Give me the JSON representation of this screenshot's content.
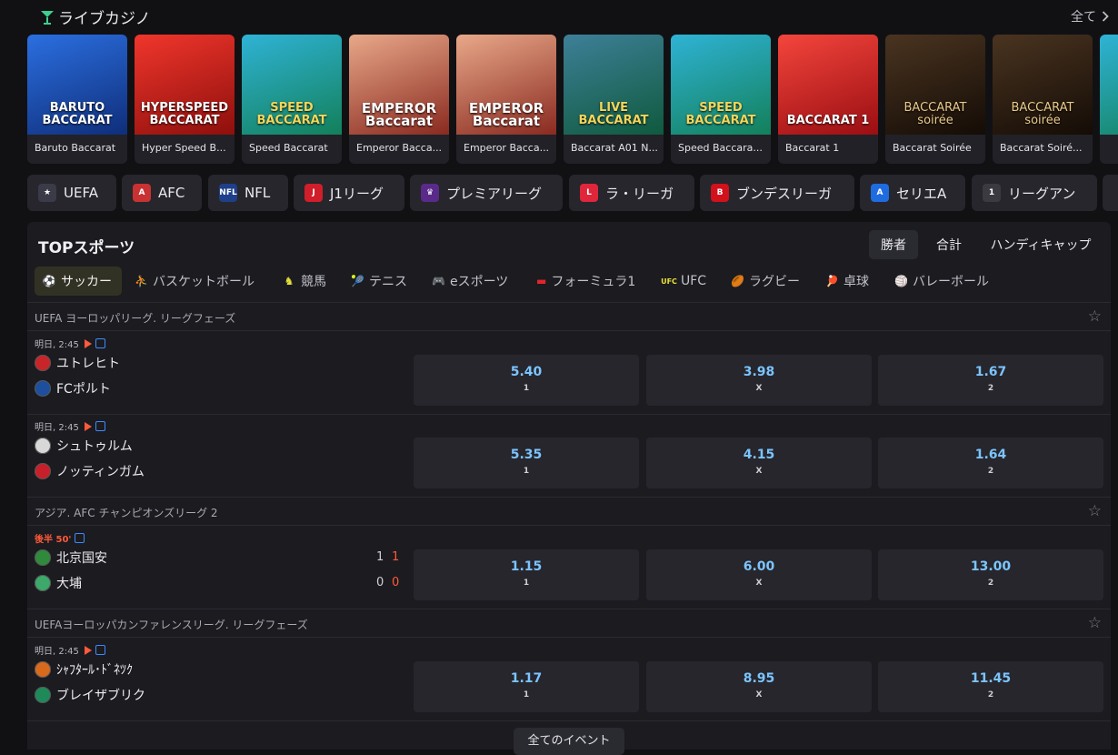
{
  "header": {
    "title": "ライブカジノ",
    "all_label": "全て"
  },
  "casino_cards": [
    {
      "name": "Baruto Baccarat",
      "art_label": "BARUTO\nBACCARAT",
      "bg": "#1a4fb8"
    },
    {
      "name": "Hyper Speed B...",
      "art_label": "HYPERSPEED\nBACCARAT",
      "bg": "#d4201c"
    },
    {
      "name": "Speed Baccarat",
      "art_label": "SPEED\nBACCARAT",
      "bg": "#1f8a6e"
    },
    {
      "name": "Emperor Bacca...",
      "art_label": "EMPEROR\nBaccarat",
      "bg": "#b03a2a"
    },
    {
      "name": "Emperor Bacca...",
      "art_label": "EMPEROR\nBaccarat",
      "bg": "#b03a2a"
    },
    {
      "name": "Baccarat A01 N...",
      "art_label": "LIVE\nBACCARAT",
      "bg": "#2d6e7e"
    },
    {
      "name": "Speed Baccara...",
      "art_label": "SPEED\nBACCARAT",
      "bg": "#1f8a6e"
    },
    {
      "name": "Baccarat 1",
      "art_label": "BACCARAT 1",
      "bg": "#c8161e"
    },
    {
      "name": "Baccarat Soirée",
      "art_label": "BACCARAT\nsoirée",
      "bg": "#2a1c10"
    },
    {
      "name": "Baccarat Soiré...",
      "art_label": "BACCARAT\nsoirée",
      "bg": "#2a1c10"
    }
  ],
  "leagues": [
    {
      "label": "UEFA",
      "icon": "uefa-icon",
      "color": "#3a3a48"
    },
    {
      "label": "AFC",
      "icon": "afc-icon",
      "color": "#c83232"
    },
    {
      "label": "NFL",
      "icon": "nfl-icon",
      "color": "#1f3f8a"
    },
    {
      "label": "J1リーグ",
      "icon": "j1-icon",
      "color": "#d01e2a"
    },
    {
      "label": "プレミアリーグ",
      "icon": "premier-league-icon",
      "color": "#5a2a8a"
    },
    {
      "label": "ラ・リーガ",
      "icon": "laliga-icon",
      "color": "#e0263a"
    },
    {
      "label": "ブンデスリーガ",
      "icon": "bundesliga-icon",
      "color": "#d1111b"
    },
    {
      "label": "セリエA",
      "icon": "serie-a-icon",
      "color": "#1f6ce0"
    },
    {
      "label": "リーグアン",
      "icon": "ligue1-icon",
      "color": "#3a3a40"
    }
  ],
  "panel": {
    "title": "TOPスポーツ",
    "markets": [
      "勝者",
      "合計",
      "ハンディキャップ"
    ],
    "sports": [
      {
        "label": "サッカー",
        "icon": "soccer-icon"
      },
      {
        "label": "バスケットボール",
        "icon": "basketball-icon"
      },
      {
        "label": "競馬",
        "icon": "horse-racing-icon"
      },
      {
        "label": "テニス",
        "icon": "tennis-icon"
      },
      {
        "label": "eスポーツ",
        "icon": "esports-icon"
      },
      {
        "label": "フォーミュラ1",
        "icon": "formula1-icon"
      },
      {
        "label": "UFC",
        "icon": "ufc-icon"
      },
      {
        "label": "ラグビー",
        "icon": "rugby-icon"
      },
      {
        "label": "卓球",
        "icon": "table-tennis-icon"
      },
      {
        "label": "バレーボール",
        "icon": "volleyball-icon"
      }
    ],
    "league_headers": [
      "UEFA ヨーロッパリーグ. リーグフェーズ",
      "アジア. AFC チャンピオンズリーグ 2",
      "UEFAヨーロッパカンファレンスリーグ. リーグフェーズ"
    ],
    "matches": [
      {
        "time": "明日, 2:45",
        "live": false,
        "team1": "ユトレヒト",
        "team2": "FCポルト",
        "odds": [
          "5.40",
          "3.98",
          "1.67"
        ]
      },
      {
        "time": "明日, 2:45",
        "live": false,
        "team1": "シュトゥルム",
        "team2": "ノッティンガム",
        "odds": [
          "5.35",
          "4.15",
          "1.64"
        ]
      },
      {
        "time": "後半 50'",
        "live": true,
        "team1": "北京国安",
        "team2": "大埔",
        "score1": [
          "1",
          "1"
        ],
        "score2": [
          "0",
          "0"
        ],
        "odds": [
          "1.15",
          "6.00",
          "13.00"
        ]
      },
      {
        "time": "明日, 2:45",
        "live": false,
        "team1": "ｼｬﾌﾀｰﾙ･ﾄﾞﾈﾂｸ",
        "team2": "ブレイザブリク",
        "odds": [
          "1.17",
          "8.95",
          "11.45"
        ]
      }
    ],
    "outcome_labels": [
      "1",
      "X",
      "2"
    ],
    "more_button": "全てのイベント"
  }
}
